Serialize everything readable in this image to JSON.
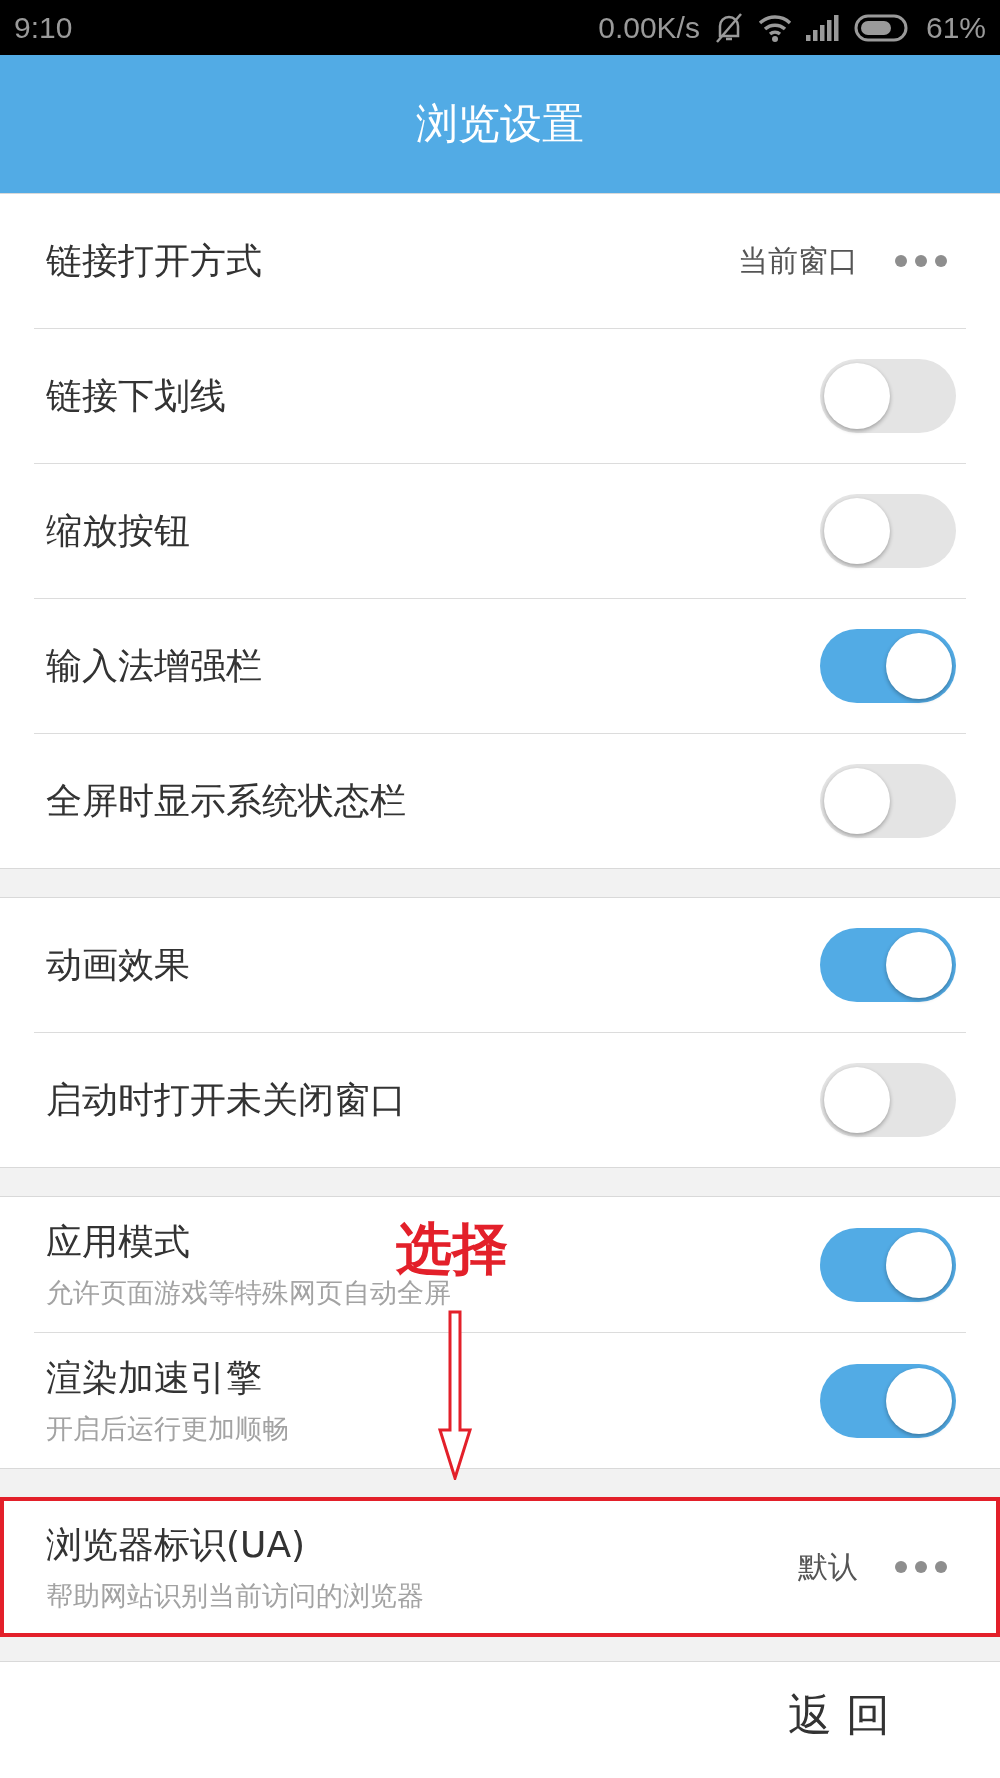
{
  "status_bar": {
    "time": "9:10",
    "speed": "0.00K/s",
    "battery": "61%"
  },
  "header": {
    "title": "浏览设置"
  },
  "sections": [
    {
      "highlighted": false,
      "items": [
        {
          "kind": "value",
          "label": "链接打开方式",
          "value": "当前窗口"
        },
        {
          "kind": "toggle",
          "label": "链接下划线",
          "on": false
        },
        {
          "kind": "toggle",
          "label": "缩放按钮",
          "on": false
        },
        {
          "kind": "toggle",
          "label": "输入法增强栏",
          "on": true
        },
        {
          "kind": "toggle",
          "label": "全屏时显示系统状态栏",
          "on": false
        }
      ]
    },
    {
      "highlighted": false,
      "items": [
        {
          "kind": "toggle",
          "label": "动画效果",
          "on": true
        },
        {
          "kind": "toggle",
          "label": "启动时打开未关闭窗口",
          "on": false
        }
      ]
    },
    {
      "highlighted": false,
      "items": [
        {
          "kind": "toggle",
          "label": "应用模式",
          "subtitle": "允许页面游戏等特殊网页自动全屏",
          "on": true
        },
        {
          "kind": "toggle",
          "label": "渲染加速引擎",
          "subtitle": "开启后运行更加顺畅",
          "on": true
        }
      ]
    },
    {
      "highlighted": true,
      "items": [
        {
          "kind": "value",
          "label": "浏览器标识(UA)",
          "subtitle": "帮助网站识别当前访问的浏览器",
          "value": "默认"
        }
      ]
    }
  ],
  "annotation": {
    "label": "选择"
  },
  "footer": {
    "back": "返回"
  }
}
